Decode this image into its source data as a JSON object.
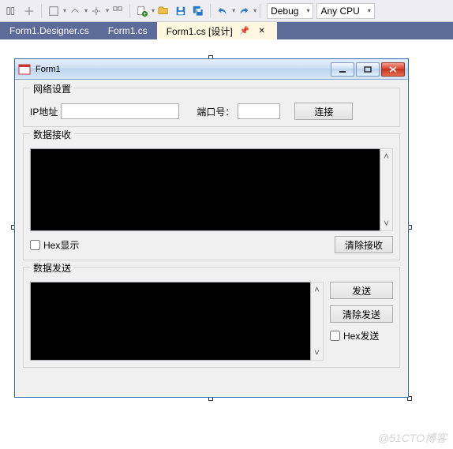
{
  "toolbar": {
    "debug": "Debug",
    "cpu": "Any CPU"
  },
  "tabs": [
    {
      "label": "Form1.Designer.cs"
    },
    {
      "label": "Form1.cs"
    },
    {
      "label": "Form1.cs [设计]"
    }
  ],
  "form": {
    "title": "Form1",
    "group_net": "网络设置",
    "ip_label": "IP地址",
    "ip_value": "",
    "port_label": "端口号：",
    "port_value": "",
    "connect_btn": "连接",
    "group_recv": "数据接收",
    "hex_show": "Hex显示",
    "clear_recv": "清除接收",
    "group_send": "数据发送",
    "send_btn": "发送",
    "clear_send": "清除发送",
    "hex_send": "Hex发送"
  },
  "watermark": "@51CTO博客"
}
